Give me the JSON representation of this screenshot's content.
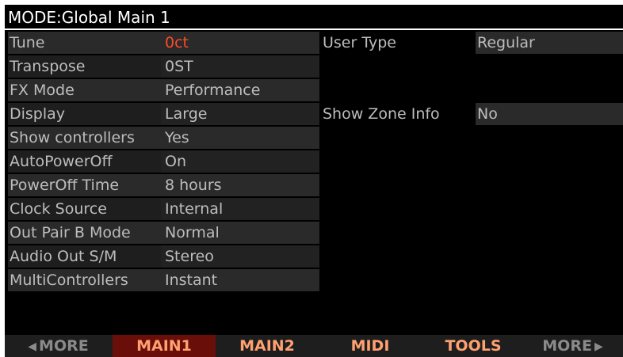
{
  "title": "MODE:Global Main 1",
  "rows": [
    {
      "label": "Tune",
      "value": "0ct",
      "right_label": "User Type",
      "right_value": "Regular"
    },
    {
      "label": "Transpose",
      "value": "0ST"
    },
    {
      "label": "FX Mode",
      "value": "Performance"
    },
    {
      "label": "Display",
      "value": "Large",
      "right_label": "Show Zone Info",
      "right_value": "No"
    },
    {
      "label": "Show controllers",
      "value": "Yes"
    },
    {
      "label": "AutoPowerOff",
      "value": "On"
    },
    {
      "label": "PowerOff Time",
      "value": "8 hours"
    },
    {
      "label": "Clock Source",
      "value": "Internal"
    },
    {
      "label": "Out Pair B Mode",
      "value": "Normal"
    },
    {
      "label": "Audio Out S/M",
      "value": "Stereo"
    },
    {
      "label": "MultiControllers",
      "value": "Instant"
    }
  ],
  "softkeys": [
    {
      "label": "MORE",
      "arrow": "◀"
    },
    {
      "label": "MAIN1"
    },
    {
      "label": "MAIN2"
    },
    {
      "label": "MIDI"
    },
    {
      "label": "TOOLS"
    },
    {
      "label": "MORE",
      "arrow": "▶"
    }
  ],
  "colors": {
    "background": "#000000",
    "field": "#2a2a2a",
    "text": "#bdbdbd",
    "selected_value": "#ff4a2a",
    "softkey_text": "#ffa070",
    "softkey_active": "#6a0e0a"
  }
}
